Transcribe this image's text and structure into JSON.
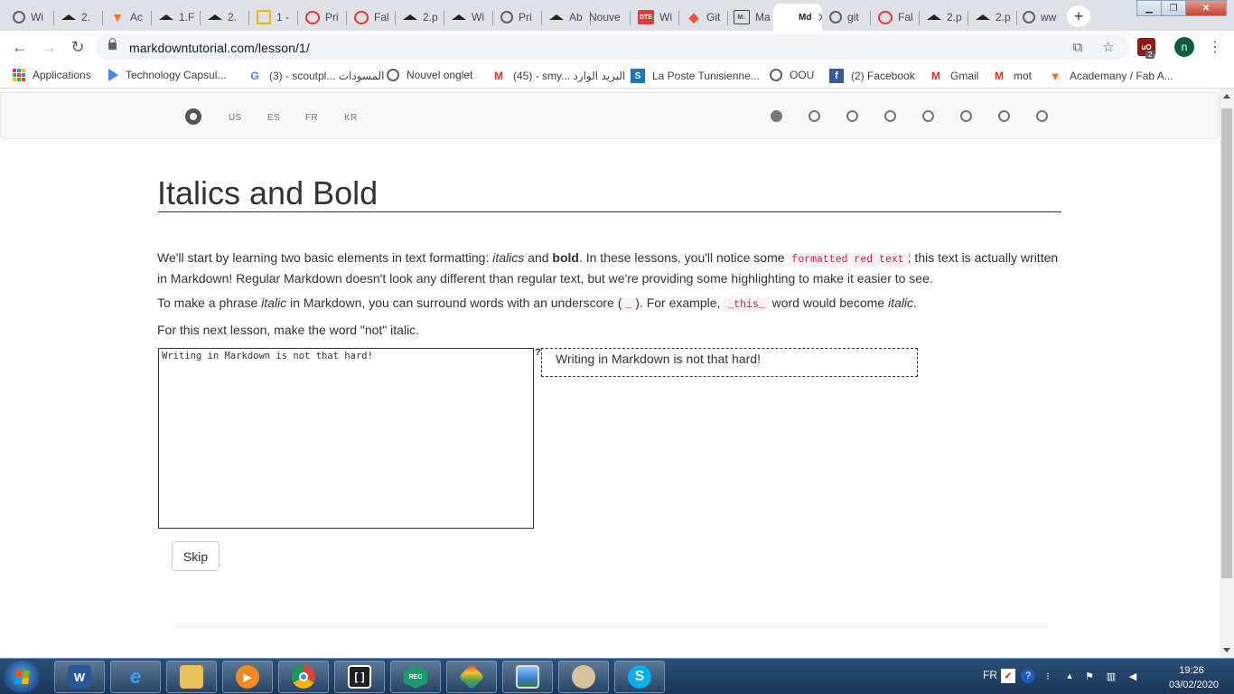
{
  "browser": {
    "tabs": [
      {
        "label": "Wi",
        "icon": "globe-icon"
      },
      {
        "label": "2.",
        "icon": "graduation-cap-icon"
      },
      {
        "label": "Ac",
        "icon": "gitlab-icon"
      },
      {
        "label": "1.F",
        "icon": "graduation-cap-icon"
      },
      {
        "label": "2.",
        "icon": "graduation-cap-icon"
      },
      {
        "label": "1 -",
        "icon": "slides-icon"
      },
      {
        "label": "Pri",
        "icon": "fablab-icon"
      },
      {
        "label": "Fal",
        "icon": "fablab-icon"
      },
      {
        "label": "2.p",
        "icon": "graduation-cap-icon"
      },
      {
        "label": "Wi",
        "icon": "graduation-cap-icon"
      },
      {
        "label": "Pri",
        "icon": "globe-icon"
      },
      {
        "label": "Ab",
        "icon": "graduation-cap-icon"
      },
      {
        "label": "Nouve",
        "icon": ""
      },
      {
        "label": "Wi",
        "icon": "dte-icon"
      },
      {
        "label": "Git",
        "icon": "git-icon"
      },
      {
        "label": "Ma",
        "icon": "markdown-icon"
      },
      {
        "label": "Md",
        "icon": "markdown-tutorial-icon",
        "active": true
      },
      {
        "label": "git",
        "icon": "globe-icon"
      },
      {
        "label": "Fal",
        "icon": "fablab-icon"
      },
      {
        "label": "2.p",
        "icon": "graduation-cap-icon"
      },
      {
        "label": "2.p",
        "icon": "graduation-cap-icon"
      },
      {
        "label": "ww",
        "icon": "globe-icon"
      }
    ],
    "dte_icon_text": "DTE",
    "md_icon_text": "M↓",
    "url": "markdowntutorial.com/lesson/1/",
    "profile_initial": "n",
    "extension_badge": "2",
    "extension_label": "uO"
  },
  "bookmarks": [
    {
      "label": "Applications",
      "icon": "apps-grid-icon"
    },
    {
      "label": "Technology Capsul...",
      "icon": "play-triangle-icon"
    },
    {
      "label": "(3) - scoutpl... المسودات",
      "icon": "google-icon"
    },
    {
      "label": "Nouvel onglet",
      "icon": "globe-icon"
    },
    {
      "label": "(45) - smy... البريد الوارد",
      "icon": "gmail-icon"
    },
    {
      "label": "La Poste Tunisienne...",
      "icon": "la-poste-icon"
    },
    {
      "label": "OOU",
      "icon": "globe-icon"
    },
    {
      "label": "(2) Facebook",
      "icon": "facebook-icon"
    },
    {
      "label": "Gmail",
      "icon": "gmail-icon"
    },
    {
      "label": "mot",
      "icon": "gmail-icon"
    },
    {
      "label": "Academany / Fab A...",
      "icon": "gitlab-icon"
    }
  ],
  "site": {
    "languages": [
      "US",
      "ES",
      "FR",
      "KR"
    ],
    "lesson_total": 8,
    "lesson_current": 1
  },
  "lesson": {
    "title": "Italics and Bold",
    "p1": {
      "a": "We'll start by learning two basic elements in text formatting: ",
      "italics": "italics",
      "b": " and ",
      "bold": "bold",
      "c": ". In these lessons, you'll notice some ",
      "code": "formatted red text",
      "d": "; this text is actually written in Markdown! Regular Markdown doesn't look any different than regular text, but we're providing some highlighting to make it easier to see."
    },
    "p2": {
      "a": "To make a phrase ",
      "italic": "italic",
      "b": " in Markdown, you can surround words with an underscore (",
      "code1": "_",
      "c": "). For example, ",
      "code2": "_this_",
      "d": " word would become ",
      "italic2": "italic",
      "e": "."
    },
    "p3": "For this next lesson, make the word \"not\" italic.",
    "editor_value": "Writing in Markdown is not that hard!",
    "help_mark": "?",
    "preview_text": "Writing in Markdown is not that hard!",
    "skip_label": "Skip"
  },
  "taskbar": {
    "apps": [
      "Word",
      "Internet Explorer",
      "File Explorer",
      "Media Player",
      "Chrome",
      "Brackets",
      "Scratch",
      "Paint",
      "Photo Viewer",
      "Paint Artist",
      "Skype"
    ],
    "word_letter": "W",
    "skype_letter": "S",
    "brackets_letter": "[ ]",
    "scratch_text": "REC",
    "language": "FR",
    "time": "19:26",
    "date": "03/02/2020"
  },
  "colors": {
    "code_red": "#c7254e",
    "code_bg": "#f9f2f4",
    "taskbar_blue": "#1b3656"
  }
}
